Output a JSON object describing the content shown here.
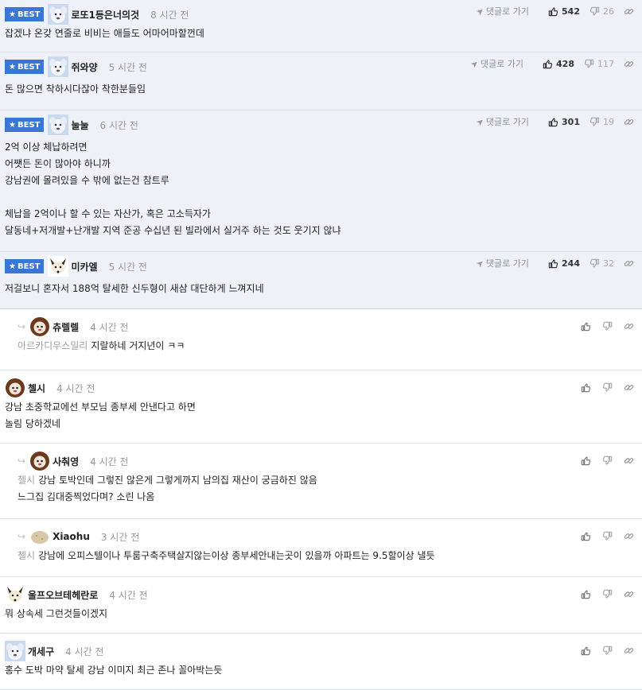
{
  "labels": {
    "best": "BEST",
    "goto_reply": "댓글로 가기"
  },
  "colors": {
    "best_bg": "#eef2f8",
    "badge": "#3a76d6"
  },
  "comments": [
    {
      "nick": "로또1등은너의것",
      "time": "8 시간 전",
      "best": true,
      "avatar": "white-dog",
      "up": "542",
      "down": "26",
      "lines": [
        "잡겠냐 온갖 연줄로 비비는 애들도 어마어마할껀데"
      ]
    },
    {
      "nick": "쥐와양",
      "time": "5 시간 전",
      "best": true,
      "avatar": "white-dog",
      "up": "428",
      "down": "117",
      "lines": [
        "돈 많으면 착하시다잖아 착한분들임"
      ]
    },
    {
      "nick": "눌눌",
      "time": "6 시간 전",
      "best": true,
      "avatar": "white-dog",
      "up": "301",
      "down": "19",
      "lines": [
        "2억 이상 체납하려면",
        "어쨋든 돈이 많아야 하니까",
        "강남권에 몰려있을 수 밖에 없는건 참트루",
        "",
        "체납을 2억이나 할 수 있는 자산가, 혹은 고소득자가",
        "달동네+저개발+난개발 지역 준공 수십년 된 빌라에서 실거주 하는 것도 웃기지 않냐"
      ]
    },
    {
      "nick": "미카엘",
      "time": "5 시간 전",
      "best": true,
      "avatar": "fox",
      "up": "244",
      "down": "32",
      "lines": [
        "저걸보니 혼자서 188억 탈세한 신두형이 새삼 대단하게 느껴지네"
      ]
    },
    {
      "nick": "츄렐렐",
      "time": "4 시간 전",
      "reply": true,
      "avatar": "lion",
      "mention": "아르카디우스밀리",
      "lines": [
        "지랄하네 거지년이 ㅋㅋ"
      ]
    },
    {
      "nick": "첼시",
      "time": "4 시간 전",
      "avatar": "lion",
      "lines": [
        "강남 초중학교에선 부모님 종부세 안낸다고 하면",
        "놀림 당하겠네"
      ]
    },
    {
      "nick": "사춰영",
      "time": "4 시간 전",
      "reply": true,
      "avatar": "lion",
      "mention": "첼시",
      "lines": [
        "강남 토박인데 그렇진 않은게 그렇게까지 남의집 재산이 궁금하진 않음",
        "느그집 김대중찍었다며? 소린 나옴"
      ]
    },
    {
      "nick": "Xiaohu",
      "time": "3 시간 전",
      "reply": true,
      "avatar": "potato",
      "mention": "첼시",
      "lines": [
        "강남에 오피스텔이나 투룸구축주택살지않는이상 종부세안내는곳이 있을까 아파트는 9.5할이상 낼듯"
      ]
    },
    {
      "nick": "울프오브테헤란로",
      "time": "4 시간 전",
      "avatar": "fox",
      "lines": [
        "뭐 상속세 그런것들이겠지"
      ]
    },
    {
      "nick": "개세구",
      "time": "4 시간 전",
      "avatar": "white-dog",
      "lines": [
        "홍수 도박 마약 탈세 강남 이미지 최근 존나 꼴아박는듯"
      ]
    }
  ]
}
